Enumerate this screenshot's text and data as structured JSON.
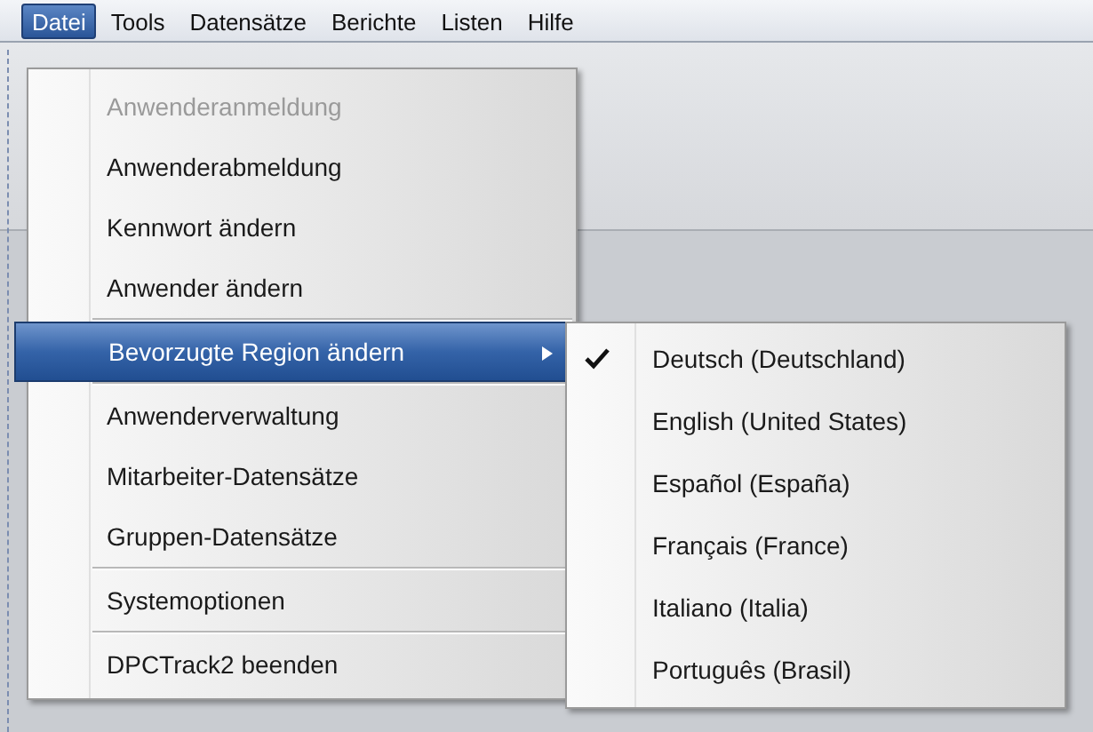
{
  "menu_bar": [
    {
      "label": "Datei",
      "selected": true
    },
    {
      "label": "Tools",
      "selected": false
    },
    {
      "label": "Datensätze",
      "selected": false
    },
    {
      "label": "Berichte",
      "selected": false
    },
    {
      "label": "Listen",
      "selected": false
    },
    {
      "label": "Hilfe",
      "selected": false
    }
  ],
  "menu": [
    {
      "label": "Anwenderanmeldung",
      "disabled": true,
      "selected": false,
      "submenu": false,
      "separator_before": false
    },
    {
      "label": "Anwenderabmeldung",
      "disabled": false,
      "selected": false,
      "submenu": false,
      "separator_before": false
    },
    {
      "label": "Kennwort ändern",
      "disabled": false,
      "selected": false,
      "submenu": false,
      "separator_before": false
    },
    {
      "label": "Anwender ändern",
      "disabled": false,
      "selected": false,
      "submenu": false,
      "separator_before": false
    },
    {
      "label": "Bevorzugte Region ändern",
      "disabled": false,
      "selected": true,
      "submenu": true,
      "separator_before": true
    },
    {
      "label": "Anwenderverwaltung",
      "disabled": false,
      "selected": false,
      "submenu": false,
      "separator_before": true
    },
    {
      "label": "Mitarbeiter-Datensätze",
      "disabled": false,
      "selected": false,
      "submenu": false,
      "separator_before": false
    },
    {
      "label": "Gruppen-Datensätze",
      "disabled": false,
      "selected": false,
      "submenu": false,
      "separator_before": false
    },
    {
      "label": "Systemoptionen",
      "disabled": false,
      "selected": false,
      "submenu": false,
      "separator_before": true
    },
    {
      "label": "DPCTrack2 beenden",
      "disabled": false,
      "selected": false,
      "submenu": false,
      "separator_before": true
    }
  ],
  "submenu": [
    {
      "label": "Deutsch (Deutschland)",
      "checked": true
    },
    {
      "label": "English (United States)",
      "checked": false
    },
    {
      "label": "Español (España)",
      "checked": false
    },
    {
      "label": "Français (France)",
      "checked": false
    },
    {
      "label": "Italiano (Italia)",
      "checked": false
    },
    {
      "label": "Português (Brasil)",
      "checked": false
    }
  ]
}
